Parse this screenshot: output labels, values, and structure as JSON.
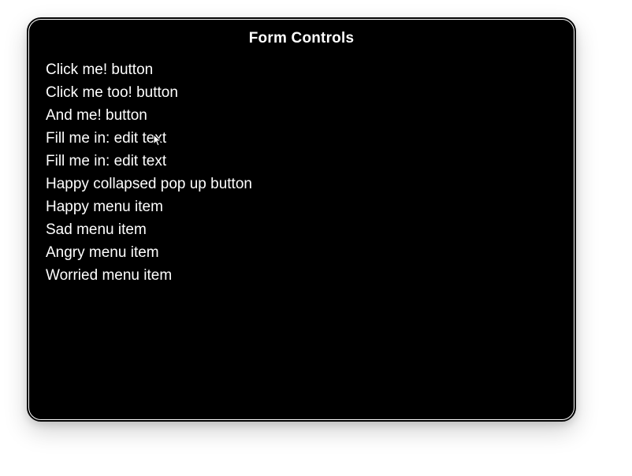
{
  "title": "Form Controls",
  "items": [
    {
      "label": "Click me! button"
    },
    {
      "label": "Click me too! button"
    },
    {
      "label": "And me! button"
    },
    {
      "label": "Fill me in: edit text"
    },
    {
      "label": "Fill me in: edit text"
    },
    {
      "label": "Happy collapsed pop up button"
    },
    {
      "label": "Happy menu item"
    },
    {
      "label": "Sad menu item"
    },
    {
      "label": "Angry menu item"
    },
    {
      "label": "Worried menu item"
    }
  ]
}
